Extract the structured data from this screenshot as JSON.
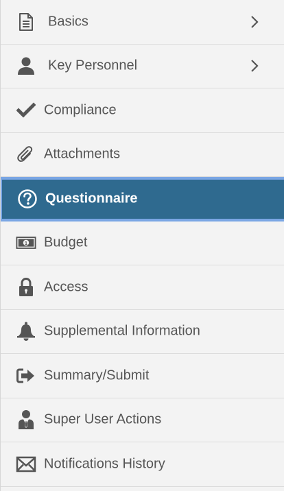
{
  "nav": {
    "items": [
      {
        "label": "Basics",
        "icon": "document-icon",
        "has_chevron": true
      },
      {
        "label": "Key Personnel",
        "icon": "person-icon",
        "has_chevron": true
      },
      {
        "label": "Compliance",
        "icon": "checkmark-icon",
        "has_chevron": false
      },
      {
        "label": "Attachments",
        "icon": "paperclip-icon",
        "has_chevron": false
      },
      {
        "label": "Questionnaire",
        "icon": "question-circle-icon",
        "has_chevron": false,
        "active": true
      },
      {
        "label": "Budget",
        "icon": "banknote-icon",
        "has_chevron": false
      },
      {
        "label": "Access",
        "icon": "lock-icon",
        "has_chevron": false
      },
      {
        "label": "Supplemental Information",
        "icon": "bell-icon",
        "has_chevron": false
      },
      {
        "label": "Summary/Submit",
        "icon": "sign-out-icon",
        "has_chevron": false
      },
      {
        "label": "Super User Actions",
        "icon": "suited-user-icon",
        "has_chevron": false
      },
      {
        "label": "Notifications History",
        "icon": "envelope-icon",
        "has_chevron": false
      }
    ]
  },
  "colors": {
    "background": "#f3f3f3",
    "text": "#555555",
    "active_background": "#2f6a8f",
    "active_border": "#7aa6e4",
    "active_text": "#ffffff"
  }
}
